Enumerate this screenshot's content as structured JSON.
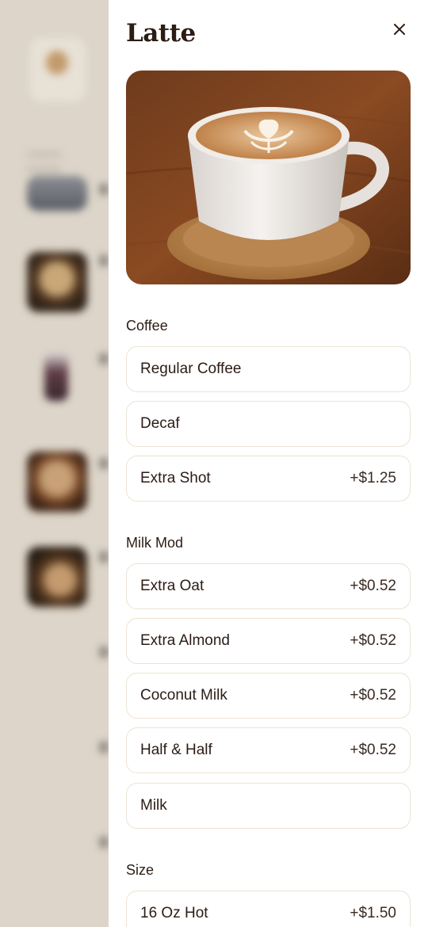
{
  "item": {
    "title": "Latte"
  },
  "icons": {
    "close": "close-icon"
  },
  "sections": [
    {
      "title": "Coffee",
      "options": [
        {
          "label": "Regular Coffee",
          "price": ""
        },
        {
          "label": "Decaf",
          "price": ""
        },
        {
          "label": "Extra Shot",
          "price": "+$1.25"
        }
      ]
    },
    {
      "title": "Milk Mod",
      "options": [
        {
          "label": "Extra Oat",
          "price": "+$0.52"
        },
        {
          "label": "Extra Almond",
          "price": "+$0.52"
        },
        {
          "label": "Coconut Milk",
          "price": "+$0.52"
        },
        {
          "label": "Half & Half",
          "price": "+$0.52"
        },
        {
          "label": "Milk",
          "price": ""
        }
      ]
    },
    {
      "title": "Size",
      "options": [
        {
          "label": "16 Oz Hot",
          "price": "+$1.50"
        }
      ]
    }
  ],
  "colors": {
    "text": "#2b1c14",
    "border": "#ece3d2",
    "backdrop": "#ddd6cb"
  }
}
